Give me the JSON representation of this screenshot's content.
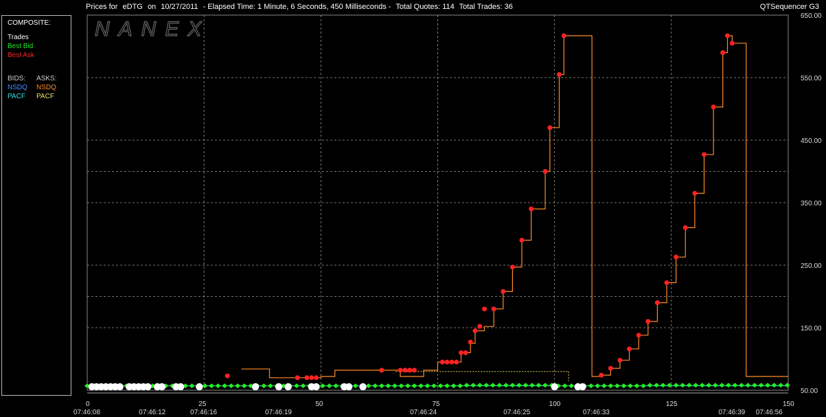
{
  "header": {
    "prefix": "Prices for",
    "symbol": "eDTG",
    "on_label": "on",
    "date": "10/27/2011",
    "elapsed": "-  Elapsed Time: 1 Minute, 6 Seconds, 450 Milliseconds  -",
    "quotes": "Total Quotes: 114",
    "trades": "Total Trades: 36"
  },
  "brand": "QTSequencer G3",
  "watermark": "NANEX",
  "legend": {
    "title": "COMPOSITE:",
    "trades": "Trades",
    "best_bid": "Best Bid",
    "best_ask": "Best Ask",
    "bids_label": "BIDS:",
    "asks_label": "ASKS:",
    "bids": [
      "NSDQ",
      "PACF"
    ],
    "asks": [
      "NSDQ",
      "PACF"
    ],
    "colors": {
      "trades": "#ffffff",
      "best_bid": "#22ee22",
      "best_ask": "#ff2222",
      "bid_nsdq": "#4a8cff",
      "bid_pacf": "#33e0e0",
      "ask_nsdq": "#ff8c2a",
      "ask_pacf": "#f0e060"
    }
  },
  "chart_data": {
    "type": "line",
    "title": "Prices for eDTG on 10/27/2011",
    "xlabel": "",
    "ylabel": "",
    "xlim": [
      0,
      150
    ],
    "ylim": [
      50,
      650
    ],
    "x_ticks": [
      "0",
      "25",
      "50",
      "75",
      "100",
      "125",
      "150"
    ],
    "y_ticks": [
      "50.00",
      "150.00",
      "250.00",
      "350.00",
      "450.00",
      "550.00",
      "650.00"
    ],
    "time_ticks": [
      {
        "x": 0,
        "label": "07:46:08"
      },
      {
        "x": 14,
        "label": "07:46:12"
      },
      {
        "x": 25,
        "label": "07:46:16"
      },
      {
        "x": 41,
        "label": "07:46:19"
      },
      {
        "x": 72,
        "label": "07:46:24"
      },
      {
        "x": 92,
        "label": "07:46:25"
      },
      {
        "x": 109,
        "label": "07:46:33"
      },
      {
        "x": 138,
        "label": "07:46:39"
      },
      {
        "x": 146,
        "label": "07:46:56"
      }
    ],
    "grid": true,
    "series": [
      {
        "name": "NSDQ",
        "role": "ask_nsdq",
        "color": "#ff8c2a",
        "step": true,
        "points": [
          [
            33,
            84
          ],
          [
            39,
            70
          ],
          [
            45,
            70
          ],
          [
            50,
            72
          ],
          [
            51,
            72
          ],
          [
            53,
            82
          ],
          [
            59,
            82
          ],
          [
            62,
            82
          ],
          [
            67,
            72
          ],
          [
            71,
            72
          ],
          [
            72,
            82
          ],
          [
            75,
            95
          ],
          [
            77,
            95
          ],
          [
            78,
            95
          ],
          [
            80,
            110
          ],
          [
            82,
            125
          ],
          [
            83,
            145
          ],
          [
            85,
            152
          ],
          [
            87,
            180
          ],
          [
            89,
            208
          ],
          [
            91,
            247
          ],
          [
            93,
            290
          ],
          [
            95,
            340
          ],
          [
            98,
            400
          ],
          [
            99,
            470
          ],
          [
            101,
            555
          ],
          [
            102,
            617
          ],
          [
            107,
            617
          ],
          [
            108,
            72
          ],
          [
            110,
            74
          ],
          [
            112,
            85
          ],
          [
            114,
            98
          ],
          [
            116,
            116
          ],
          [
            118,
            138
          ],
          [
            120,
            160
          ],
          [
            122,
            190
          ],
          [
            124,
            222
          ],
          [
            126,
            263
          ],
          [
            128,
            310
          ],
          [
            130,
            365
          ],
          [
            132,
            427
          ],
          [
            134,
            503
          ],
          [
            136,
            590
          ],
          [
            137,
            617
          ],
          [
            138,
            605
          ],
          [
            140,
            605
          ],
          [
            141,
            72
          ],
          [
            150,
            72
          ]
        ]
      },
      {
        "name": "PACF",
        "role": "ask_pacf",
        "color": "#f0e060",
        "step": true,
        "points": [
          [
            66,
            80
          ],
          [
            103,
            80
          ],
          [
            103,
            65
          ]
        ]
      },
      {
        "name": "PACF",
        "role": "bid_pacf",
        "color": "#33e0e0",
        "step": true,
        "points": [
          [
            0,
            57
          ],
          [
            140,
            57
          ],
          [
            150,
            60
          ]
        ]
      },
      {
        "name": "Best Ask",
        "role": "best_ask",
        "color": "#ff2222",
        "points": [
          [
            30,
            73
          ],
          [
            45,
            70
          ],
          [
            47,
            70
          ],
          [
            48,
            70
          ],
          [
            49,
            70
          ],
          [
            63,
            82
          ],
          [
            67,
            82
          ],
          [
            68,
            82
          ],
          [
            69,
            82
          ],
          [
            70,
            82
          ],
          [
            76,
            95
          ],
          [
            77,
            95
          ],
          [
            78,
            95
          ],
          [
            79,
            95
          ],
          [
            80,
            110
          ],
          [
            81,
            110
          ],
          [
            82,
            127
          ],
          [
            83,
            145
          ],
          [
            84,
            152
          ],
          [
            85,
            180
          ],
          [
            87,
            180
          ],
          [
            89,
            208
          ],
          [
            91,
            247
          ],
          [
            93,
            290
          ],
          [
            95,
            340
          ],
          [
            98,
            400
          ],
          [
            99,
            470
          ],
          [
            101,
            555
          ],
          [
            102,
            617
          ],
          [
            110,
            74
          ],
          [
            112,
            85
          ],
          [
            114,
            98
          ],
          [
            116,
            116
          ],
          [
            118,
            138
          ],
          [
            120,
            160
          ],
          [
            122,
            190
          ],
          [
            124,
            222
          ],
          [
            126,
            263
          ],
          [
            128,
            310
          ],
          [
            130,
            365
          ],
          [
            132,
            427
          ],
          [
            134,
            503
          ],
          [
            136,
            590
          ],
          [
            137,
            617
          ],
          [
            138,
            605
          ]
        ]
      },
      {
        "name": "Best Bid",
        "role": "best_bid",
        "color": "#22ee22",
        "points": [
          [
            0,
            57
          ],
          [
            10,
            57
          ],
          [
            20,
            57
          ],
          [
            30,
            57
          ],
          [
            40,
            57
          ],
          [
            50,
            57
          ],
          [
            60,
            57
          ],
          [
            70,
            57
          ],
          [
            80,
            58
          ],
          [
            90,
            58
          ],
          [
            100,
            57
          ],
          [
            110,
            57
          ],
          [
            120,
            58
          ],
          [
            130,
            58
          ],
          [
            140,
            58
          ],
          [
            150,
            58
          ]
        ]
      },
      {
        "name": "Trades",
        "role": "trades",
        "color": "#ffffff",
        "points": [
          [
            1,
            61
          ],
          [
            2,
            61
          ],
          [
            3,
            61
          ],
          [
            4,
            61
          ],
          [
            5,
            61
          ],
          [
            6,
            61
          ],
          [
            7,
            61
          ],
          [
            9,
            61
          ],
          [
            10,
            61
          ],
          [
            11,
            61
          ],
          [
            12,
            61
          ],
          [
            13,
            61
          ],
          [
            15,
            61
          ],
          [
            16,
            61
          ],
          [
            19,
            61
          ],
          [
            20,
            61
          ],
          [
            24,
            61
          ],
          [
            36,
            61
          ],
          [
            41,
            61
          ],
          [
            43,
            61
          ],
          [
            48,
            61
          ],
          [
            49,
            61
          ],
          [
            55,
            61
          ],
          [
            56,
            61
          ],
          [
            59,
            61
          ],
          [
            100,
            61
          ],
          [
            105,
            61
          ],
          [
            106,
            61
          ]
        ]
      }
    ]
  }
}
